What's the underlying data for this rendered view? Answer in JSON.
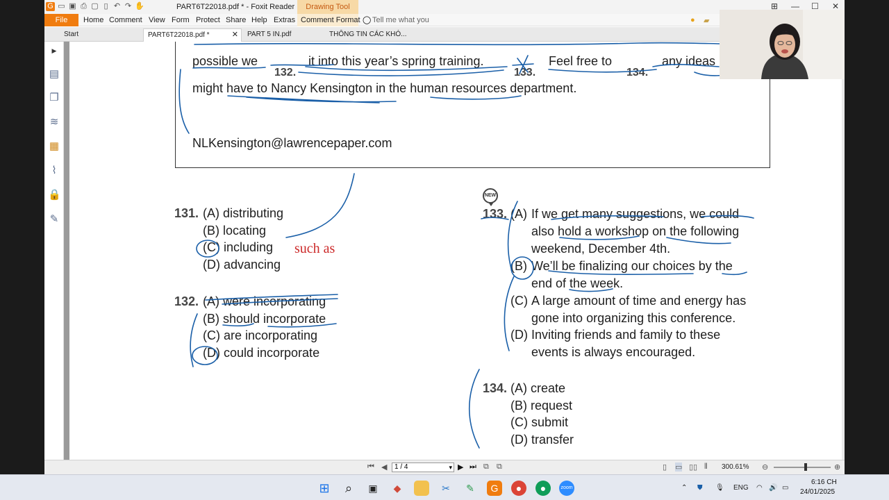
{
  "app": {
    "doc_title": "PART6T22018.pdf * - Foxit Reader",
    "drawing_tool": "Drawing Tool",
    "tell_me": "Tell me what you"
  },
  "menu": {
    "file": "File",
    "items": [
      "Home",
      "Comment",
      "View",
      "Form",
      "Protect",
      "Share",
      "Help",
      "Extras",
      "Comment Format"
    ]
  },
  "tabs": [
    {
      "label": "Start"
    },
    {
      "label": "PART6T22018.pdf *"
    },
    {
      "label": "PART 5 IN.pdf"
    },
    {
      "label": "THÔNG TIN CÁC KHÓ..."
    }
  ],
  "passage": {
    "line1_a": "possible we",
    "line1_b": "it into this year’s spring training.",
    "line1_c": "Feel free to",
    "line1_d": "any ideas",
    "blank_132": "132.",
    "blank_133": "133.",
    "blank_134": "134.",
    "line2": "might have to Nancy Kensington in the human resources department.",
    "email": "NLKensington@lawrencepaper.com"
  },
  "q131": {
    "num": "131.",
    "options": [
      "(A) distributing",
      "(B) locating",
      "(C) including",
      "(D) advancing"
    ]
  },
  "q132": {
    "num": "132.",
    "options": [
      "(A) were incorporating",
      "(B) should incorporate",
      "(C) are incorporating",
      "(D) could incorporate"
    ]
  },
  "q133": {
    "num": "133.",
    "badge": "NEW",
    "options": [
      {
        "letter": "(A)",
        "lines": [
          "If we get many suggestions, we could",
          "also hold a workshop on the following",
          "weekend, December 4th."
        ]
      },
      {
        "letter": "(B)",
        "lines": [
          "We’ll be finalizing our choices by the",
          "end of the week."
        ]
      },
      {
        "letter": "(C)",
        "lines": [
          "A large amount of time and energy has",
          "gone into organizing this conference."
        ]
      },
      {
        "letter": "(D)",
        "lines": [
          "Inviting friends and family to these",
          "events is always encouraged."
        ]
      }
    ]
  },
  "q134": {
    "num": "134.",
    "options": [
      "(A) create",
      "(B) request",
      "(C) submit",
      "(D) transfer"
    ]
  },
  "annotation": {
    "such_as": "such as"
  },
  "status": {
    "page_indicator": "1 / 4",
    "zoom": "300.61%"
  },
  "taskbar": {
    "lang": "ENG",
    "time": "6:16 CH",
    "date": "24/01/2025"
  },
  "colors": {
    "accent": "#f07c0f",
    "ink": "#1a5fa8",
    "annotation_red": "#cc2a2a",
    "drawing_tool_tab": "#f7d9a6"
  }
}
